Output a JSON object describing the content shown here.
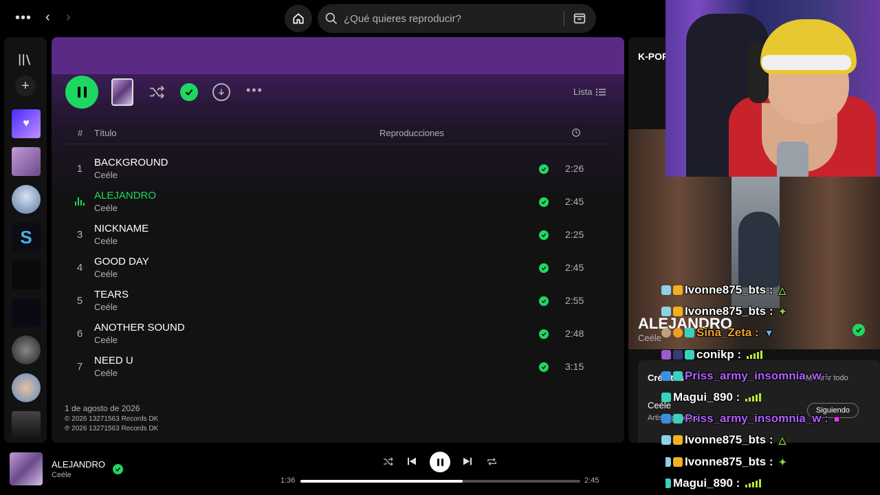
{
  "search": {
    "placeholder": "¿Qué quieres reproducir?"
  },
  "toolbar": {
    "view_label": "Lista"
  },
  "table_header": {
    "num": "#",
    "title": "Título",
    "plays": "Reproducciones"
  },
  "tracks": [
    {
      "num": "1",
      "title": "BACKGROUND",
      "artist": "Ceéle",
      "duration": "2:26"
    },
    {
      "num": "2",
      "title": "ALEJANDRO",
      "artist": "Ceéle",
      "duration": "2:45"
    },
    {
      "num": "3",
      "title": "NICKNAME",
      "artist": "Ceéle",
      "duration": "2:25"
    },
    {
      "num": "4",
      "title": "GOOD DAY",
      "artist": "Ceéle",
      "duration": "2:45"
    },
    {
      "num": "5",
      "title": "TEARS",
      "artist": "Ceéle",
      "duration": "2:55"
    },
    {
      "num": "6",
      "title": "ANOTHER SOUND",
      "artist": "Ceéle",
      "duration": "2:48"
    },
    {
      "num": "7",
      "title": "NEED U",
      "artist": "Ceéle",
      "duration": "3:15"
    }
  ],
  "release": {
    "date": "1 de agosto de 2026",
    "copyright": "© 2026 13271563 Records DK",
    "phonographic": "℗ 2026 13271563 Records DK"
  },
  "right_panel": {
    "title": "K-POP",
    "song": "ALEJANDRO",
    "artist": "Ceéle",
    "credits_label": "Créditos",
    "show_all": "Mostrar todo",
    "credit_artist": "Ceéle",
    "credit_role": "Artista principal",
    "follow_label": "Siguiendo"
  },
  "chat": [
    {
      "user": "Ivonne875_bts :",
      "color": "#ffffff"
    },
    {
      "user": "Ivonne875_bts :",
      "color": "#ffffff"
    },
    {
      "user": "Sina_Zeta :",
      "color": "#f0a030"
    },
    {
      "user": "conikp :",
      "color": "#ffffff"
    },
    {
      "user": "Priss_army_insomnia_w :",
      "color": "#b060ff"
    },
    {
      "user": "Magui_890 :",
      "color": "#ffffff"
    },
    {
      "user": "Priss_army_insomnia_w :",
      "color": "#b060ff"
    },
    {
      "user": "Ivonne875_bts :",
      "color": "#ffffff"
    },
    {
      "user": "Ivonne875_bts :",
      "color": "#ffffff"
    },
    {
      "user": "Magui_890 :",
      "color": "#ffffff"
    }
  ],
  "player": {
    "title": "ALEJANDRO",
    "artist": "Ceéle",
    "elapsed": "1:36",
    "total": "2:45",
    "progress": 0.58
  },
  "colors": {
    "accent": "#1ed760",
    "header_purple": "#5a2a85"
  }
}
